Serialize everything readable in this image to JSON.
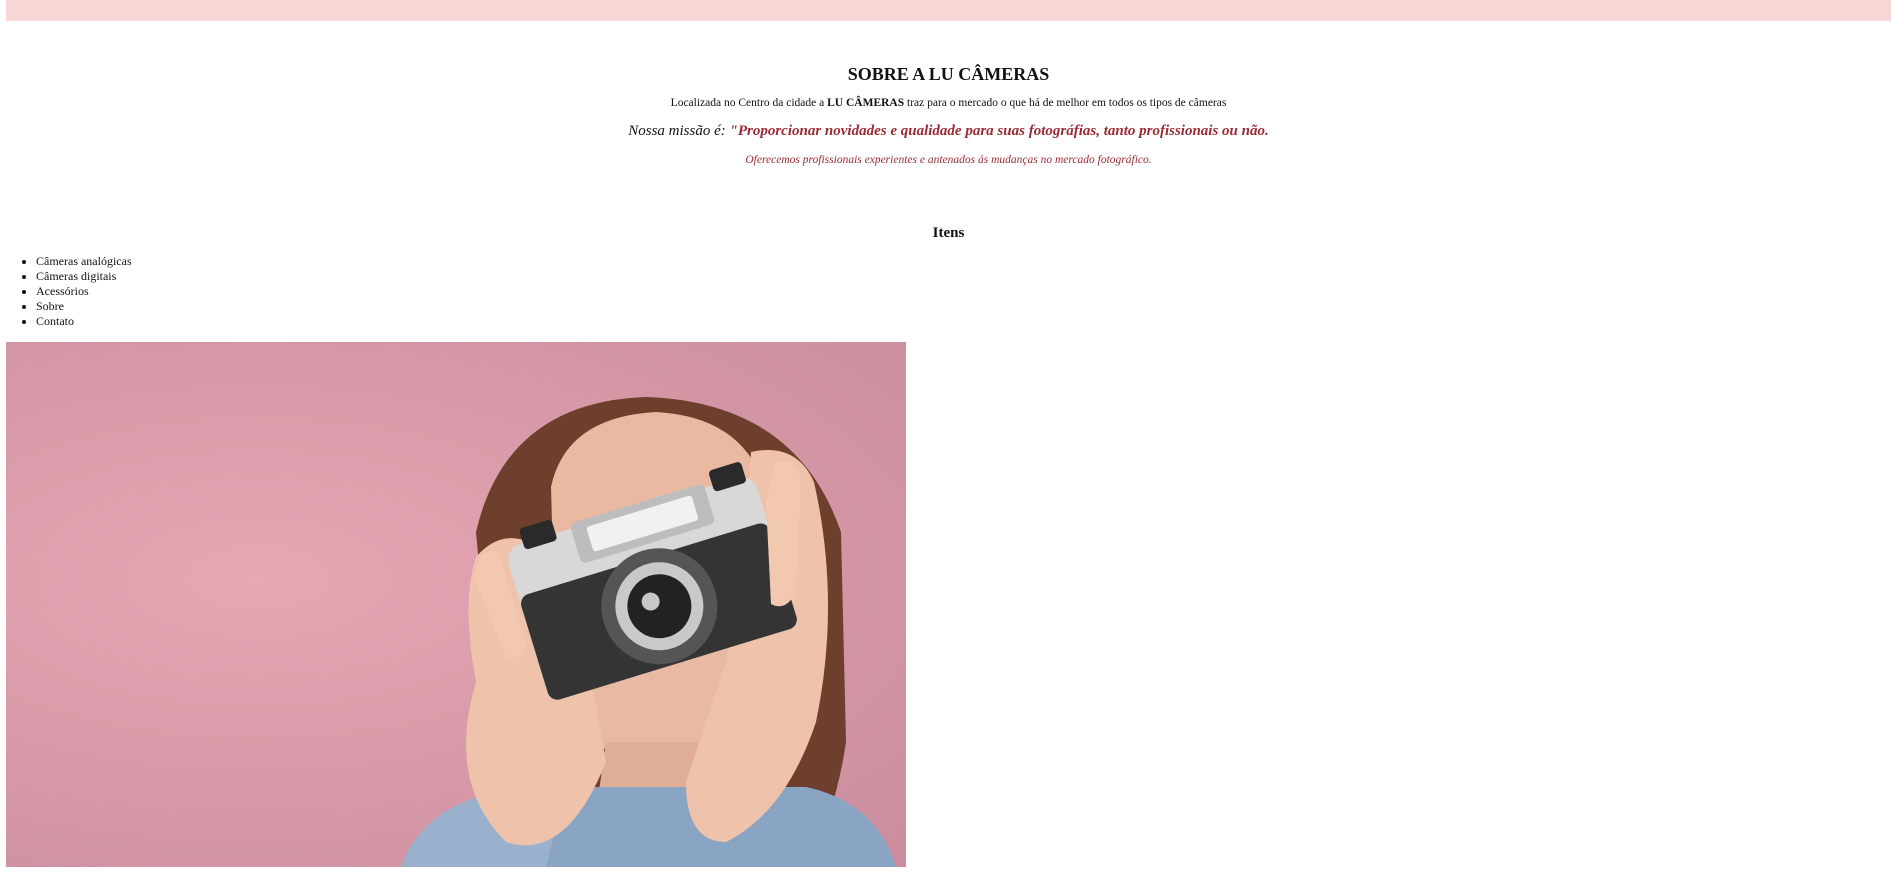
{
  "about": {
    "title": "SOBRE A LU CÂMERAS",
    "intro_before": "Localizada no Centro da cidade a ",
    "intro_brand": "LU CÂMERAS",
    "intro_after": " traz para o mercado o que há de melhor em todos os tipos de câmeras",
    "mission_label": "Nossa missão é: ",
    "mission_quote": "\"Proporcionar novidades e qualidade para suas fotográfias, tanto profissionais ou não.",
    "offer": "Oferecemos profissionais experientes e antenados ás mudanças no mercado fotográfico."
  },
  "items": {
    "title": "Itens",
    "list": [
      {
        "label": "Câmeras analógicas"
      },
      {
        "label": "Câmeras digitais"
      },
      {
        "label": "Acessórios"
      },
      {
        "label": "Sobre"
      },
      {
        "label": "Contato"
      }
    ]
  },
  "hero": {
    "background_color": "#d99aa9",
    "subject": "woman-holding-vintage-camera"
  },
  "colors": {
    "top_bar": "#f8d6d6",
    "accent": "#9b2a34"
  }
}
